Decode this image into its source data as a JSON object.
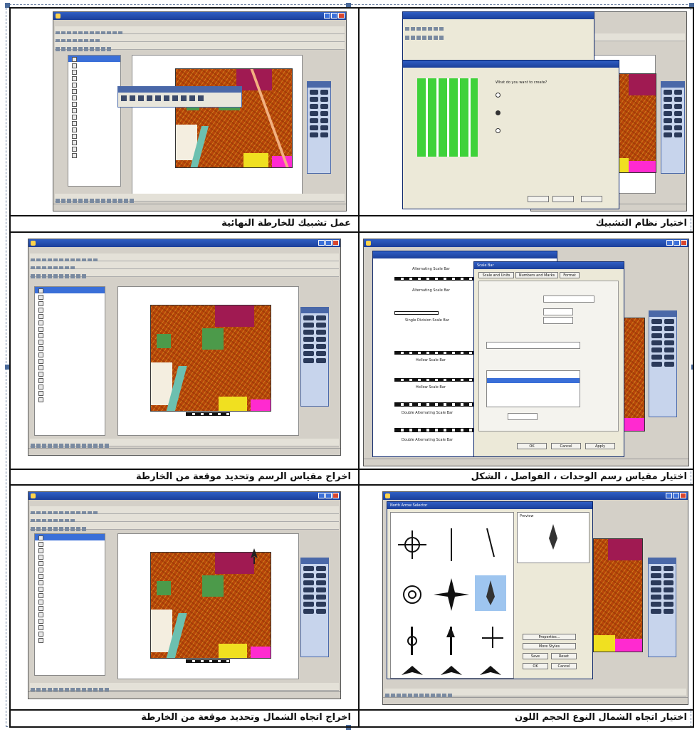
{
  "captions": {
    "top_right": "اختيار نظام التشبيك",
    "top_left": "عمل تشبيك للخارطة النهائية",
    "mid_right": "اختيار مقياس رسم الوحدات ، الفواصل ، الشكل",
    "mid_left": "اخراج مقياس الرسم وتحديد موقعة من الخارطة",
    "bot_right": "اختيار اتجاه الشمال النوع الحجم اللون",
    "bot_left": "اخراج اتجاه الشمال وتحديد موقعة من الخارطة"
  },
  "colors": {
    "map_base": "#b8460a",
    "map_magenta": "#a01a52",
    "map_green": "#4c9a4a",
    "map_river": "#6cc0b0",
    "map_yellow": "#f0e020",
    "map_pink": "#ff2ad0",
    "window_title": "#1b3f9a"
  },
  "icons": [
    "window-icon",
    "minimize-icon",
    "maximize-icon",
    "close-icon",
    "toolbar-icon",
    "north-arrow-icon",
    "tools-palette-icon"
  ],
  "dialogs": {
    "grid_wizard": {
      "question": "What do you want to create?"
    },
    "scale_bar": {
      "title": "Scale Bar",
      "tabs": [
        "Scale and Units",
        "Numbers and Marks",
        "Format"
      ],
      "items": [
        "Alternating Scale Bar",
        "Alternating Scale Bar",
        "Single Division Scale Bar",
        "Hollow Scale Bar",
        "Hollow Scale Bar",
        "Double Alternating Scale Bar",
        "Double Alternating Scale Bar"
      ],
      "ok": "OK",
      "cancel": "Cancel",
      "apply": "Apply"
    },
    "north_arrow": {
      "title": "North Arrow Selector",
      "preview": "Preview",
      "properties": "Properties...",
      "more_styles": "More Styles",
      "save": "Save",
      "reset": "Reset",
      "ok": "OK",
      "cancel": "Cancel"
    }
  }
}
